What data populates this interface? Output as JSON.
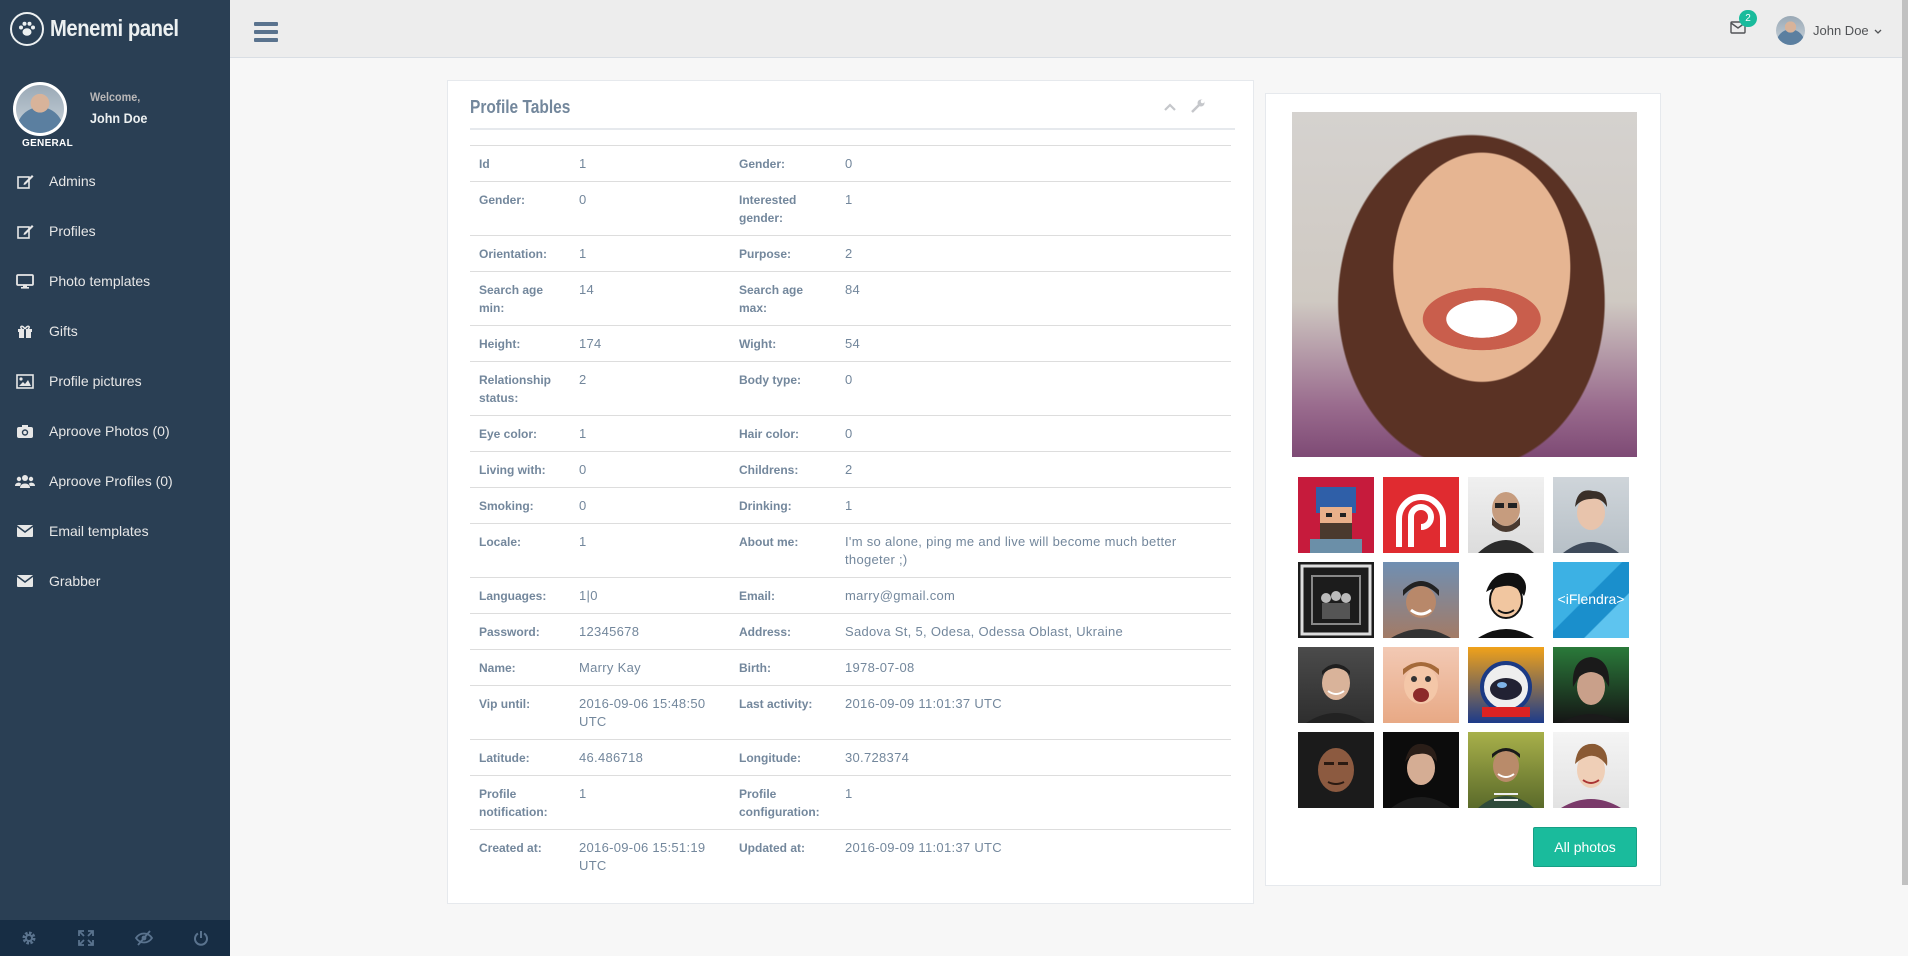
{
  "app": {
    "title": "Menemi panel"
  },
  "sidebar": {
    "welcome": "Welcome,",
    "user_name": "John Doe",
    "role": "GENERAL",
    "items": [
      {
        "label": "Admins",
        "icon": "edit-icon"
      },
      {
        "label": "Profiles",
        "icon": "edit-icon"
      },
      {
        "label": "Photo templates",
        "icon": "desktop-icon"
      },
      {
        "label": "Gifts",
        "icon": "gift-icon"
      },
      {
        "label": "Profile pictures",
        "icon": "picture-icon"
      },
      {
        "label": "Aproove Photos (0)",
        "icon": "camera-icon"
      },
      {
        "label": "Aproove Profiles (0)",
        "icon": "users-icon"
      },
      {
        "label": "Email templates",
        "icon": "envelope-icon"
      },
      {
        "label": "Grabber",
        "icon": "envelope-icon"
      }
    ],
    "footer": [
      "settings-icon",
      "fullscreen-icon",
      "lock-icon",
      "logout-icon"
    ]
  },
  "topbar": {
    "mail_count": "2",
    "user_name": "John Doe"
  },
  "panel": {
    "title": "Profile Tables",
    "rows": [
      [
        "Id",
        "1",
        "Gender:",
        "0"
      ],
      [
        "Gender:",
        "0",
        "Interested gender:",
        "1"
      ],
      [
        "Orientation:",
        "1",
        "Purpose:",
        "2"
      ],
      [
        "Search age min:",
        "14",
        "Search age max:",
        "84"
      ],
      [
        "Height:",
        "174",
        "Wight:",
        "54"
      ],
      [
        "Relationship status:",
        "2",
        "Body type:",
        "0"
      ],
      [
        "Eye color:",
        "1",
        "Hair color:",
        "0"
      ],
      [
        "Living with:",
        "0",
        "Childrens:",
        "2"
      ],
      [
        "Smoking:",
        "0",
        "Drinking:",
        "1"
      ],
      [
        "Locale:",
        "1",
        "About me:",
        "I'm so alone, ping me and live will become much better thogeter ;)"
      ],
      [
        "Languages:",
        "1|0",
        "Email:",
        "marry@gmail.com"
      ],
      [
        "Password:",
        "12345678",
        "Address:",
        "Sadova St, 5, Odesa, Odessa Oblast, Ukraine"
      ],
      [
        "Name:",
        "Marry Kay",
        "Birth:",
        "1978-07-08"
      ],
      [
        "Vip until:",
        "2016-09-06 15:48:50 UTC",
        "Last activity:",
        "2016-09-09 11:01:37 UTC"
      ],
      [
        "Latitude:",
        "46.486718",
        "Longitude:",
        "30.728374"
      ],
      [
        "Profile notification:",
        "1",
        "Profile configuration:",
        "1"
      ],
      [
        "Created at:",
        "2016-09-06 15:51:19 UTC",
        "Updated at:",
        "2016-09-09 11:01:37 UTC"
      ]
    ]
  },
  "photos": {
    "thumb_text": "<iFlendra>",
    "all_button": "All photos",
    "colors": {
      "accent": "#1abb9c",
      "sidebar": "#2a3f54"
    }
  }
}
